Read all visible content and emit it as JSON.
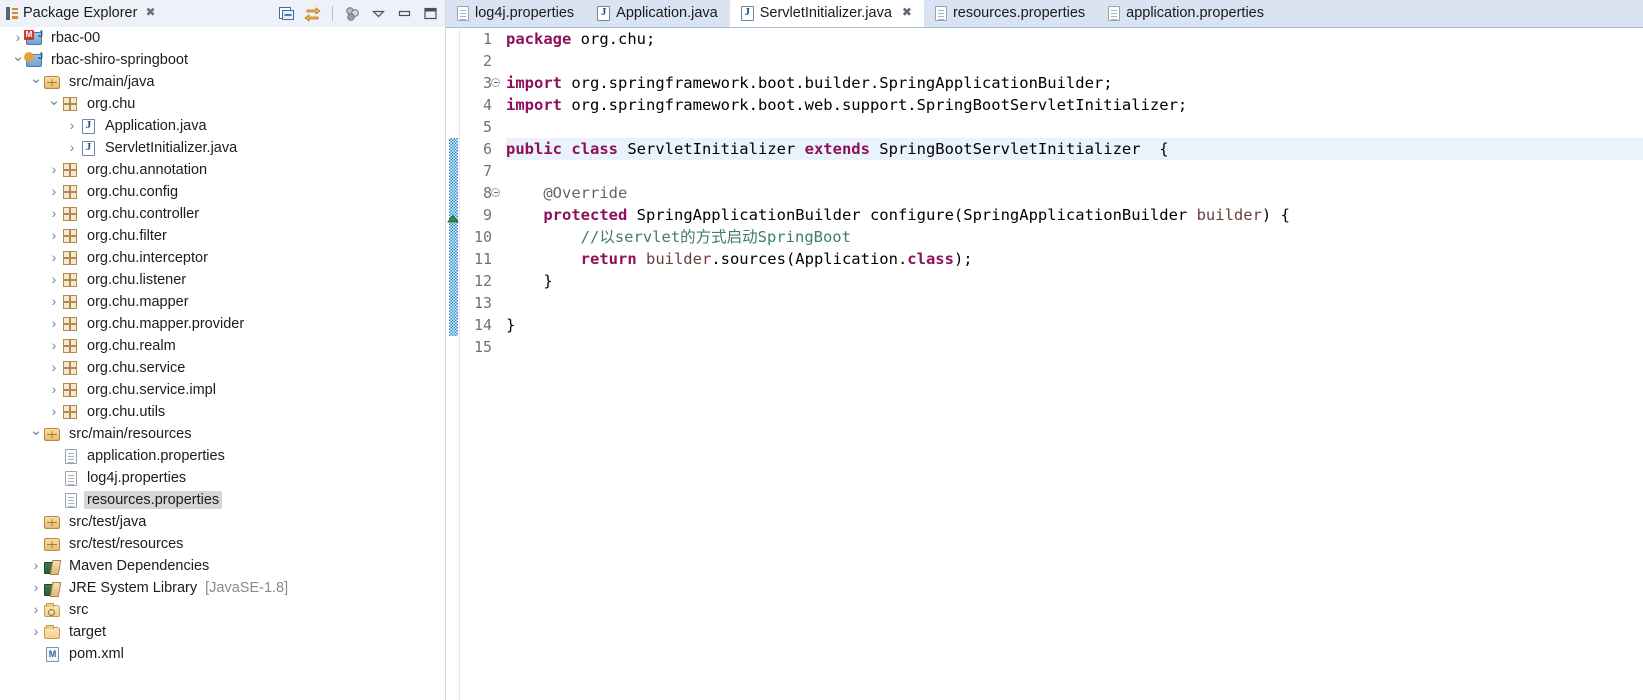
{
  "explorer": {
    "tab": {
      "label": "Package Explorer",
      "close_glyph": "✖",
      "icon": "package-explorer-icon"
    },
    "toolbar": [
      {
        "name": "collapse-all-button",
        "icon": "collapse-all-icon"
      },
      {
        "name": "link-with-editor-button",
        "icon": "link-editor-icon"
      },
      {
        "name": "view-menu-filters-button",
        "icon": "filters-icon"
      },
      {
        "name": "view-menu-button",
        "icon": "chevron-down-icon"
      },
      {
        "name": "minimize-button",
        "icon": "minimize-icon"
      },
      {
        "name": "maximize-button",
        "icon": "maximize-icon"
      }
    ],
    "tree": [
      {
        "label": "rbac-00",
        "indent": 0,
        "arrow": "collapsed",
        "icon": "maven-project-icon",
        "selected": false
      },
      {
        "label": "rbac-shiro-springboot",
        "indent": 0,
        "arrow": "expanded",
        "icon": "maven-project-icon",
        "selected": false
      },
      {
        "label": "src/main/java",
        "indent": 1,
        "arrow": "expanded",
        "icon": "source-folder-icon",
        "selected": false
      },
      {
        "label": "org.chu",
        "indent": 2,
        "arrow": "expanded",
        "icon": "package-icon",
        "selected": false
      },
      {
        "label": "Application.java",
        "indent": 3,
        "arrow": "collapsed",
        "icon": "java-file-icon",
        "selected": false
      },
      {
        "label": "ServletInitializer.java",
        "indent": 3,
        "arrow": "collapsed",
        "icon": "java-file-icon",
        "selected": false
      },
      {
        "label": "org.chu.annotation",
        "indent": 2,
        "arrow": "collapsed",
        "icon": "package-icon",
        "selected": false
      },
      {
        "label": "org.chu.config",
        "indent": 2,
        "arrow": "collapsed",
        "icon": "package-icon",
        "selected": false
      },
      {
        "label": "org.chu.controller",
        "indent": 2,
        "arrow": "collapsed",
        "icon": "package-icon",
        "selected": false
      },
      {
        "label": "org.chu.filter",
        "indent": 2,
        "arrow": "collapsed",
        "icon": "package-icon",
        "selected": false
      },
      {
        "label": "org.chu.interceptor",
        "indent": 2,
        "arrow": "collapsed",
        "icon": "package-icon",
        "selected": false
      },
      {
        "label": "org.chu.listener",
        "indent": 2,
        "arrow": "collapsed",
        "icon": "package-icon",
        "selected": false
      },
      {
        "label": "org.chu.mapper",
        "indent": 2,
        "arrow": "collapsed",
        "icon": "package-icon",
        "selected": false
      },
      {
        "label": "org.chu.mapper.provider",
        "indent": 2,
        "arrow": "collapsed",
        "icon": "package-icon",
        "selected": false
      },
      {
        "label": "org.chu.realm",
        "indent": 2,
        "arrow": "collapsed",
        "icon": "package-icon",
        "selected": false
      },
      {
        "label": "org.chu.service",
        "indent": 2,
        "arrow": "collapsed",
        "icon": "package-icon",
        "selected": false
      },
      {
        "label": "org.chu.service.impl",
        "indent": 2,
        "arrow": "collapsed",
        "icon": "package-icon",
        "selected": false
      },
      {
        "label": "org.chu.utils",
        "indent": 2,
        "arrow": "collapsed",
        "icon": "package-icon",
        "selected": false
      },
      {
        "label": "src/main/resources",
        "indent": 1,
        "arrow": "expanded",
        "icon": "source-folder-icon",
        "selected": false
      },
      {
        "label": "application.properties",
        "indent": 2,
        "arrow": "none",
        "icon": "properties-file-icon",
        "selected": false
      },
      {
        "label": "log4j.properties",
        "indent": 2,
        "arrow": "none",
        "icon": "properties-file-icon",
        "selected": false
      },
      {
        "label": "resources.properties",
        "indent": 2,
        "arrow": "none",
        "icon": "properties-file-icon",
        "selected": true
      },
      {
        "label": "src/test/java",
        "indent": 1,
        "arrow": "none",
        "icon": "source-folder-icon",
        "selected": false
      },
      {
        "label": "src/test/resources",
        "indent": 1,
        "arrow": "none",
        "icon": "source-folder-icon",
        "selected": false
      },
      {
        "label": "Maven Dependencies",
        "indent": 1,
        "arrow": "collapsed",
        "icon": "library-icon",
        "selected": false
      },
      {
        "label": "JRE System Library",
        "indent": 1,
        "arrow": "collapsed",
        "icon": "library-icon",
        "selected": false,
        "suffix": "[JavaSE-1.8]"
      },
      {
        "label": "src",
        "indent": 1,
        "arrow": "collapsed",
        "icon": "folder-key-icon",
        "selected": false
      },
      {
        "label": "target",
        "indent": 1,
        "arrow": "collapsed",
        "icon": "folder-icon",
        "selected": false
      },
      {
        "label": "pom.xml",
        "indent": 1,
        "arrow": "none",
        "icon": "pom-file-icon",
        "selected": false
      }
    ]
  },
  "editor": {
    "tabs": [
      {
        "label": "log4j.properties",
        "icon": "properties-file-icon",
        "active": false,
        "closable": false
      },
      {
        "label": "Application.java",
        "icon": "java-file-icon",
        "active": false,
        "closable": false
      },
      {
        "label": "ServletInitializer.java",
        "icon": "java-file-icon",
        "active": true,
        "closable": true,
        "close_glyph": "✖"
      },
      {
        "label": "resources.properties",
        "icon": "properties-file-icon",
        "active": false,
        "closable": false
      },
      {
        "label": "application.properties",
        "icon": "properties-file-icon",
        "active": false,
        "closable": false
      }
    ],
    "line_numbers": [
      "1",
      "2",
      "3",
      "4",
      "5",
      "6",
      "7",
      "8",
      "9",
      "10",
      "11",
      "12",
      "13",
      "14",
      "15"
    ],
    "fold_marks": [
      3,
      8
    ],
    "current_line": 6,
    "change_bar": {
      "from_line": 6,
      "to_line": 14
    },
    "quickfix_marker_line": 9,
    "code_lines": [
      {
        "n": 1,
        "tokens": [
          {
            "t": "package ",
            "c": "kw"
          },
          {
            "t": "org.chu;",
            "c": "plain"
          }
        ]
      },
      {
        "n": 2,
        "tokens": []
      },
      {
        "n": 3,
        "tokens": [
          {
            "t": "import ",
            "c": "kw"
          },
          {
            "t": "org.springframework.boot.builder.SpringApplicationBuilder;",
            "c": "plain"
          }
        ]
      },
      {
        "n": 4,
        "tokens": [
          {
            "t": "import ",
            "c": "kw"
          },
          {
            "t": "org.springframework.boot.web.support.SpringBootServletInitializer;",
            "c": "plain"
          }
        ]
      },
      {
        "n": 5,
        "tokens": []
      },
      {
        "n": 6,
        "tokens": [
          {
            "t": "public ",
            "c": "kw"
          },
          {
            "t": "class ",
            "c": "kw"
          },
          {
            "t": "ServletInitializer ",
            "c": "plain"
          },
          {
            "t": "extends ",
            "c": "kw"
          },
          {
            "t": "SpringBootServletInitializer  {",
            "c": "plain"
          }
        ]
      },
      {
        "n": 7,
        "tokens": []
      },
      {
        "n": 8,
        "tokens": [
          {
            "t": "    @Override",
            "c": "ann"
          }
        ]
      },
      {
        "n": 9,
        "tokens": [
          {
            "t": "    ",
            "c": "plain"
          },
          {
            "t": "protected ",
            "c": "kw"
          },
          {
            "t": "SpringApplicationBuilder configure(SpringApplicationBuilder ",
            "c": "plain"
          },
          {
            "t": "builder",
            "c": "var"
          },
          {
            "t": ") {",
            "c": "plain"
          }
        ]
      },
      {
        "n": 10,
        "tokens": [
          {
            "t": "        //以",
            "c": "cmt"
          },
          {
            "t": "servlet",
            "c": "cmt-sq"
          },
          {
            "t": "的方式启动SpringBoot",
            "c": "cmt"
          }
        ]
      },
      {
        "n": 11,
        "tokens": [
          {
            "t": "        ",
            "c": "plain"
          },
          {
            "t": "return ",
            "c": "kw"
          },
          {
            "t": "builder",
            "c": "var"
          },
          {
            "t": ".sources(Application.",
            "c": "plain"
          },
          {
            "t": "class",
            "c": "kw"
          },
          {
            "t": ");",
            "c": "plain"
          }
        ]
      },
      {
        "n": 12,
        "tokens": [
          {
            "t": "    }",
            "c": "plain"
          }
        ]
      },
      {
        "n": 13,
        "tokens": []
      },
      {
        "n": 14,
        "tokens": [
          {
            "t": "}",
            "c": "plain"
          }
        ]
      },
      {
        "n": 15,
        "tokens": []
      }
    ]
  },
  "colors": {
    "tab_bar_bg": "#d9e3f2",
    "view_tab_bg": "#eef1f7",
    "selection_bg": "#d6d6d6",
    "current_line_bg": "#eaf2fb",
    "keyword": "#8e0f5a",
    "comment": "#3f7f5f",
    "field": "#6a3d3d",
    "change_bar": "#1884c7"
  }
}
